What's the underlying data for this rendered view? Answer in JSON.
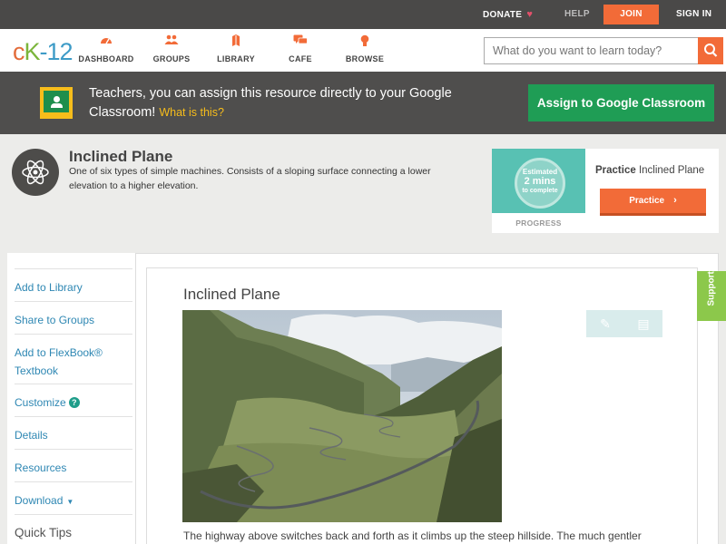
{
  "topbar": {
    "donate": "DONATE",
    "help": "HELP",
    "join": "JOIN",
    "signin": "SIGN IN"
  },
  "nav": {
    "logo": {
      "c": "c",
      "k": "K",
      "dash": "-",
      "n": "12"
    },
    "items": [
      {
        "label": "DASHBOARD",
        "icon": "dashboard-icon"
      },
      {
        "label": "GROUPS",
        "icon": "groups-icon"
      },
      {
        "label": "LIBRARY",
        "icon": "library-icon"
      },
      {
        "label": "CAFE",
        "icon": "cafe-icon"
      },
      {
        "label": "BROWSE",
        "icon": "browse-icon"
      }
    ],
    "search_placeholder": "What do you want to learn today?"
  },
  "banner": {
    "text": "Teachers, you can assign this resource directly to your Google Classroom!",
    "what_link": "What is this?",
    "assign_button": "Assign to Google Classroom"
  },
  "concept": {
    "title": "Inclined Plane",
    "description": "One of six types of simple machines. Consists of a sloping surface connecting a lower elevation to a higher elevation."
  },
  "practice": {
    "estimated": "Estimated",
    "minutes": "2 mins",
    "to_complete": "to complete",
    "progress": "PROGRESS",
    "title_bold": "Practice",
    "title_rest": " Inclined Plane",
    "button": "Practice"
  },
  "sidebar": {
    "items": [
      "Add to Library",
      "Share to Groups",
      "Add to FlexBook® Textbook",
      "Customize",
      "Details",
      "Resources",
      "Download",
      "Quick Tips"
    ]
  },
  "article": {
    "title": "Inclined Plane",
    "caption": "The highway above switches back and forth as it climbs up the steep hillside. The much gentler"
  },
  "support": "Support",
  "colors": {
    "accent": "#f26b38",
    "green": "#1f9d55",
    "link": "#2e87b3",
    "support": "#8cc84b"
  }
}
